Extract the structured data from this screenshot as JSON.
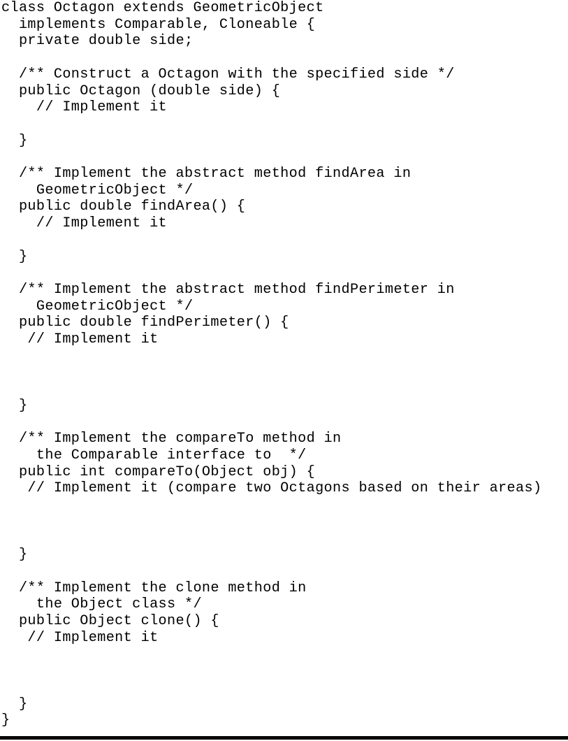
{
  "document": {
    "kind": "java-source-listing",
    "class_name": "Octagon",
    "superclass": "GeometricObject",
    "interfaces": [
      "Comparable",
      "Cloneable"
    ],
    "background_color": "#ffffff",
    "text_color": "#000000",
    "rule_color": "#000000"
  },
  "code": {
    "language": "java",
    "text": "class Octagon extends GeometricObject\n  implements Comparable, Cloneable {\n  private double side;\n\n  /** Construct a Octagon with the specified side */\n  public Octagon (double side) {\n    // Implement it\n\n  }\n\n  /** Implement the abstract method findArea in\n    GeometricObject */\n  public double findArea() {\n    // Implement it\n\n  }\n\n  /** Implement the abstract method findPerimeter in\n    GeometricObject */\n  public double findPerimeter() {\n   // Implement it\n\n\n\n  }\n\n  /** Implement the compareTo method in\n    the Comparable interface to  */\n  public int compareTo(Object obj) {\n   // Implement it (compare two Octagons based on their areas)\n\n\n\n  }\n\n  /** Implement the clone method in\n    the Object class */\n  public Object clone() {\n   // Implement it\n\n\n\n  }\n}",
    "lines": [
      "class Octagon extends GeometricObject",
      "  implements Comparable, Cloneable {",
      "  private double side;",
      "",
      "  /** Construct a Octagon with the specified side */",
      "  public Octagon (double side) {",
      "    // Implement it",
      "",
      "  }",
      "",
      "  /** Implement the abstract method findArea in",
      "    GeometricObject */",
      "  public double findArea() {",
      "    // Implement it",
      "",
      "  }",
      "",
      "  /** Implement the abstract method findPerimeter in",
      "    GeometricObject */",
      "  public double findPerimeter() {",
      "   // Implement it",
      "",
      "",
      "",
      "  }",
      "",
      "  /** Implement the compareTo method in",
      "    the Comparable interface to  */",
      "  public int compareTo(Object obj) {",
      "   // Implement it (compare two Octagons based on their areas)",
      "",
      "",
      "",
      "  }",
      "",
      "  /** Implement the clone method in",
      "    the Object class */",
      "  public Object clone() {",
      "   // Implement it",
      "",
      "",
      "",
      "  }",
      "}"
    ]
  }
}
